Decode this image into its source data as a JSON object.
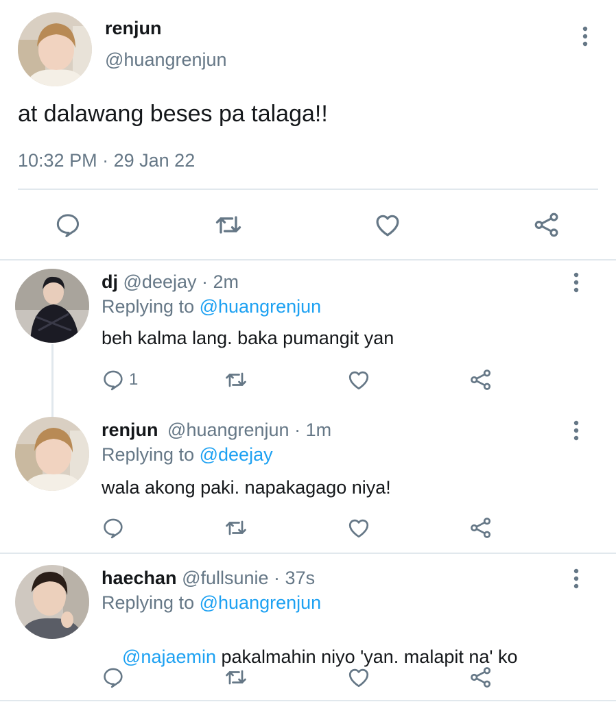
{
  "main_tweet": {
    "display_name": "renjun",
    "handle": "@huangrenjun",
    "text": "at dalawang beses pa talaga!!",
    "time": "10:32 PM",
    "date": "29 Jan 22",
    "separator": "·"
  },
  "replies": [
    {
      "display_name": "dj",
      "handle": "@deejay",
      "age": "2m",
      "replying_prefix": "Replying to",
      "replying_to": "@huangrenjun",
      "mention": "",
      "text": "beh kalma lang. baka pumangit yan",
      "reply_count": "1"
    },
    {
      "display_name": "renjun",
      "handle": "@huangrenjun",
      "age": "1m",
      "replying_prefix": "Replying to",
      "replying_to": "@deejay",
      "mention": "",
      "text": "wala akong paki. napakagago niya!",
      "reply_count": ""
    },
    {
      "display_name": "haechan",
      "handle": "@fullsunie",
      "age": "37s",
      "replying_prefix": "Replying to",
      "replying_to": "@huangrenjun",
      "mention": "@najaemin",
      "text": " pakalmahin niyo 'yan. malapit na' ko",
      "reply_count": ""
    }
  ],
  "dot_sep": " · ",
  "colors": {
    "link": "#1da1f2",
    "muted": "#657786",
    "text": "#14171a",
    "divider": "#e1e8ed"
  },
  "icons": [
    "comment-icon",
    "retweet-icon",
    "heart-icon",
    "share-icon",
    "more-icon"
  ]
}
